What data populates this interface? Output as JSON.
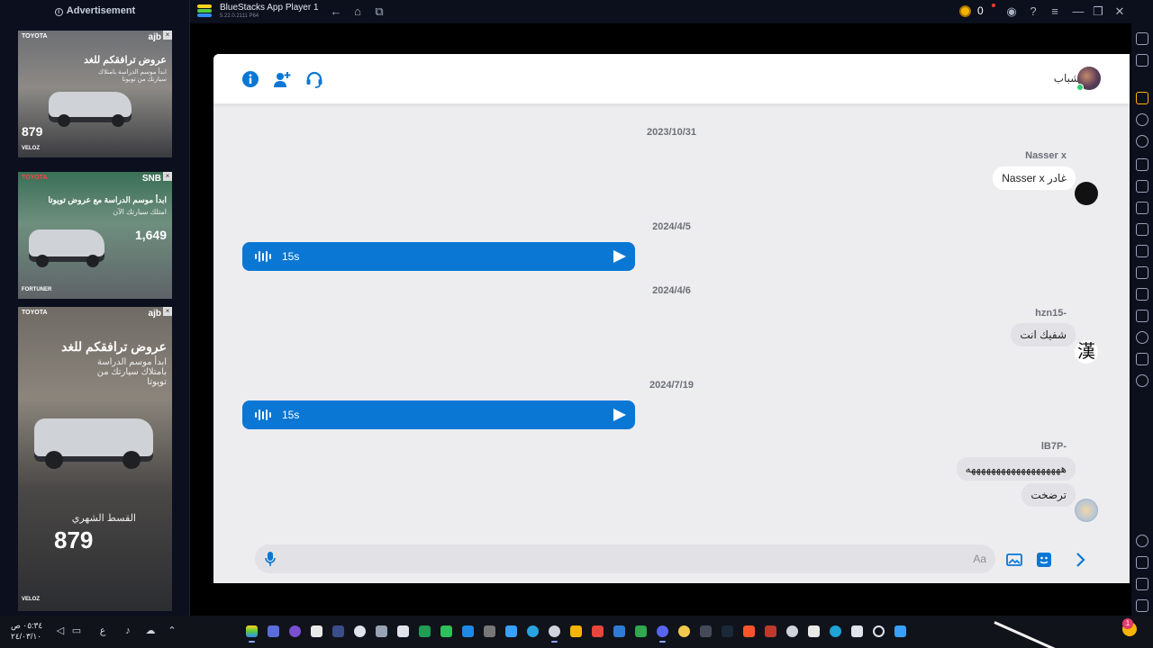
{
  "ads": {
    "label": "Advertisement",
    "items": [
      {
        "brand": "TOYOTA",
        "bank": "ajb",
        "headline": "عروض ترافقكم للغد",
        "sub": "ابدأ موسم الدراسة بامتلاك سيارتك من تويوتا",
        "price": "879",
        "model": "VELOZ"
      },
      {
        "brand": "TOYOTA",
        "bank": "SNB",
        "headline": "ابدأ موسم الدراسة مع عروض تويوتا",
        "sub": "امتلك سيارتك الآن",
        "price": "1,649",
        "model": "FORTUNER"
      },
      {
        "brand": "TOYOTA",
        "bank": "ajb",
        "headline": "عروض ترافقكم للغد",
        "sub": "ابدأ موسم الدراسة بامتلاك سيارتك من تويوتا",
        "price_label": "القسط الشهري",
        "price": "879",
        "model": "VELOZ"
      }
    ]
  },
  "window": {
    "title": "BlueStacks App Player 1",
    "version": "5.22.0.2111 P64",
    "coins": "0"
  },
  "chat": {
    "name": "الشباب",
    "composer_placeholder": "Aa",
    "messages": [
      {
        "type": "date",
        "text": "2023/10/31"
      },
      {
        "type": "text",
        "sender": "Nasser x",
        "text": "Nasser x غادر"
      },
      {
        "type": "date",
        "text": "2024/4/5"
      },
      {
        "type": "voice",
        "duration": "15s"
      },
      {
        "type": "date",
        "text": "2024/4/6"
      },
      {
        "type": "text",
        "sender": "hzn15-",
        "text": "شفيك انت"
      },
      {
        "type": "date",
        "text": "2024/7/19"
      },
      {
        "type": "voice",
        "duration": "15s"
      },
      {
        "type": "text",
        "sender": "lB7P-",
        "text": "هههههههههههههههههههه"
      },
      {
        "type": "text",
        "text": "ترضخت"
      }
    ],
    "avatar_glyph": "漢"
  },
  "taskbar": {
    "time": "٠٥:٣٤ ص",
    "date": "٢٤/٠٣/١٠",
    "lang": "ع",
    "notifications": "1"
  },
  "colors": {
    "accent": "#0a77d4",
    "online": "#2ecc71",
    "background": "#ededef"
  },
  "icons": [
    "info-icon",
    "add-user-icon",
    "support-icon",
    "mic-icon",
    "gallery-icon",
    "sticker-icon",
    "send-arrow-icon",
    "play-icon",
    "waveform-icon"
  ]
}
